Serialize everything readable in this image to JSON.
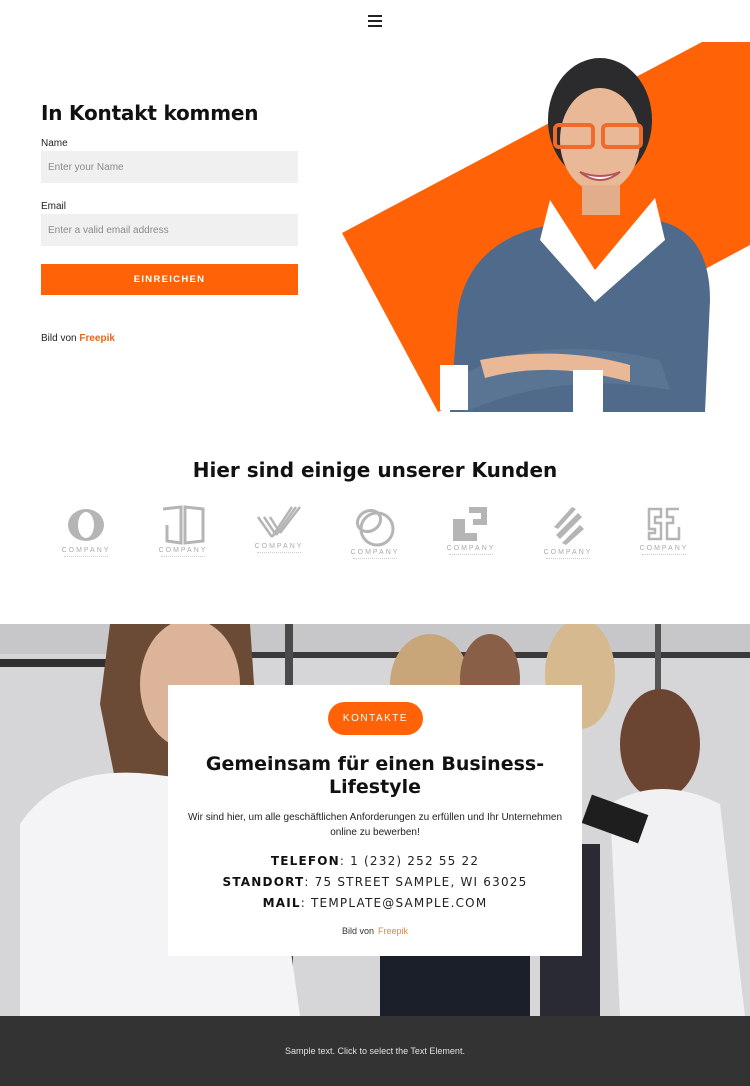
{
  "header": {
    "menu_icon": "hamburger-menu-icon"
  },
  "contact_form": {
    "title": "In Kontakt kommen",
    "name_label": "Name",
    "name_placeholder": "Enter your Name",
    "name_value": "",
    "email_label": "Email",
    "email_placeholder": "Enter a valid email address",
    "email_value": "",
    "submit_label": "EINREICHEN",
    "credit_prefix": "Bild von",
    "credit_link": "Freepik"
  },
  "hero": {
    "image": "smiling-businesswoman-with-glasses",
    "accent_color": "#ff6207"
  },
  "clients": {
    "title": "Hier sind einige unserer Kunden",
    "logos": [
      {
        "name": "COMPANY",
        "icon": "oval-swoosh-logo-icon"
      },
      {
        "name": "COMPANY",
        "icon": "open-book-logo-icon"
      },
      {
        "name": "COMPANY",
        "icon": "striped-v-logo-icon"
      },
      {
        "name": "COMPANY",
        "icon": "interlocking-circles-logo-icon"
      },
      {
        "name": "COMPANY",
        "icon": "stepped-squares-logo-icon"
      },
      {
        "name": "COMPANY",
        "icon": "diagonal-bars-logo-icon"
      },
      {
        "name": "COMPANY",
        "icon": "mirrored-brackets-logo-icon"
      }
    ]
  },
  "contact_card": {
    "badge_label": "KONTAKTE",
    "title": "Gemeinsam für einen Business-Lifestyle",
    "text": "Wir sind hier, um alle geschäftlichen Anforderungen zu erfüllen und Ihr Unternehmen online zu bewerben!",
    "phone_label": "TELEFON",
    "phone_value": ": 1 (232) 252 55 22",
    "location_label": "STANDORT",
    "location_value": ": 75 STREET SAMPLE, WI 63025",
    "mail_label": "MAIL",
    "mail_value": ": TEMPLATE@SAMPLE.COM",
    "credit_prefix": "Bild von",
    "credit_link": "Freepik"
  },
  "background_image": "women-in-office-blurred",
  "footer": {
    "text": "Sample text. Click to select the Text Element."
  },
  "colors": {
    "accent": "#ff6207",
    "footer_bg": "#333333",
    "input_bg": "#f0f0f0",
    "link": "#e5661e"
  }
}
